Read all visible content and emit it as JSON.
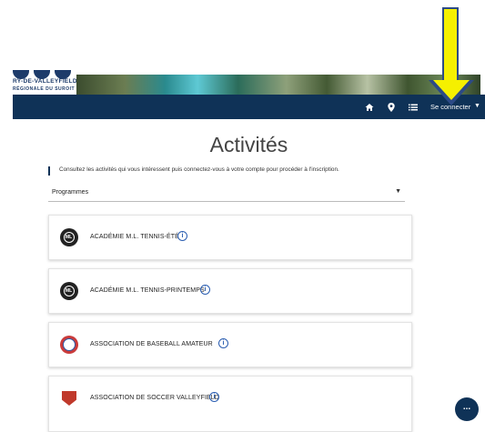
{
  "header": {
    "logo_line1": "RY-DE-VALLEYFIELD",
    "logo_line2": "RÉGIONALE DU SUROIT",
    "nav": {
      "home_icon": "home-icon",
      "location_icon": "map-pin-icon",
      "list_icon": "list-icon",
      "login_label": "Se connecter"
    }
  },
  "main": {
    "title": "Activités",
    "intro": "Consultez les activités qui vous intéressent puis connectez-vous à votre compte pour procéder à l'inscription.",
    "filter": {
      "selected": "Programmes"
    },
    "cards": [
      {
        "title": "ACADÉMIE M.L. TENNIS-ÉTÉ",
        "logo": "ml-logo",
        "logo_text": "ML"
      },
      {
        "title": "ACADÉMIE M.L. TENNIS-PRINTEMPS",
        "logo": "ml-logo",
        "logo_text": "ML"
      },
      {
        "title": "ASSOCIATION DE BASEBALL AMATEUR",
        "logo": "baseball-logo"
      },
      {
        "title": "ASSOCIATION DE SOCCER VALLEYFIELD",
        "logo": "soccer-logo"
      }
    ],
    "fab_label": "..."
  },
  "colors": {
    "navy": "#0f3257",
    "annotation_yellow": "#f5f000",
    "info_blue": "#2a5db0"
  }
}
